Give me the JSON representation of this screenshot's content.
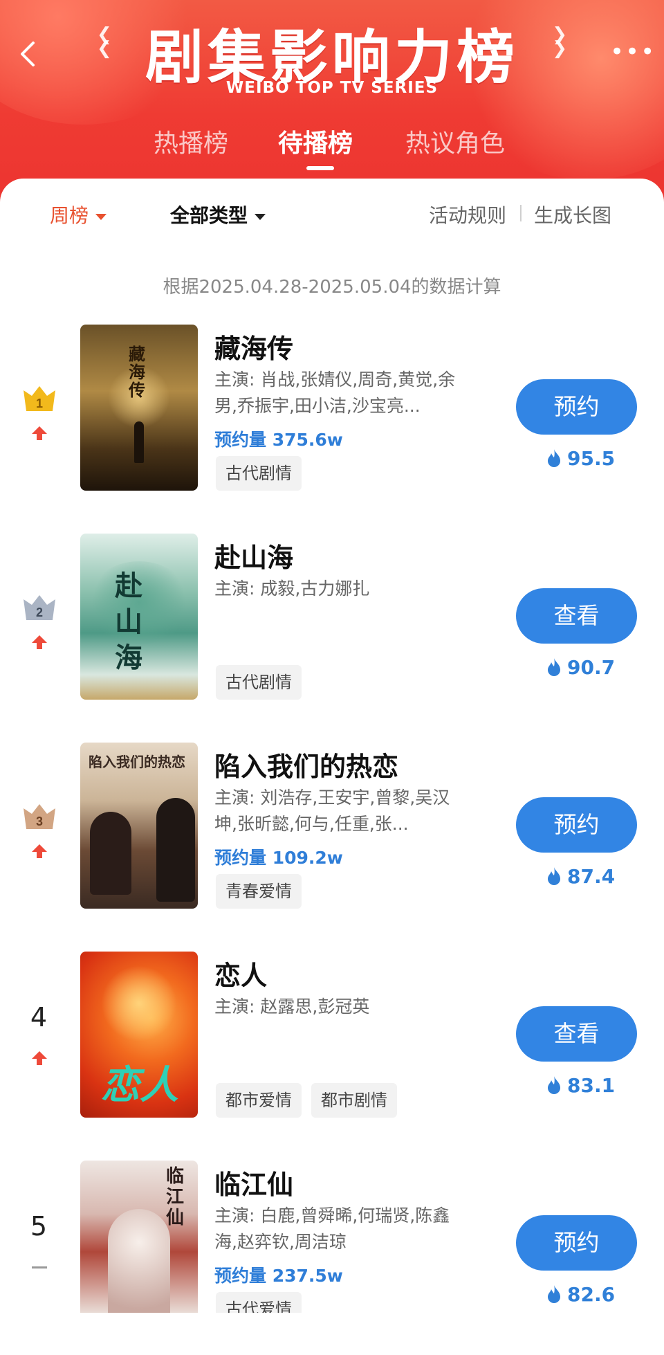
{
  "header": {
    "title": "剧集影响力榜",
    "subtitle": "WEIBO TOP TV SERIES",
    "tabs": [
      {
        "label": "热播榜",
        "active": false
      },
      {
        "label": "待播榜",
        "active": true
      },
      {
        "label": "热议角色",
        "active": false
      }
    ]
  },
  "filters": {
    "period": "周榜",
    "type": "全部类型",
    "rules": "活动规则",
    "generate_image": "生成长图"
  },
  "data_note": "根据2025.04.28-2025.05.04的数据计算",
  "colors": {
    "header_red": "#ef3b33",
    "accent_blue": "#3285e4",
    "filter_red": "#e8512f"
  },
  "shows": [
    {
      "rank": "1",
      "trend": "up",
      "title": "藏海传",
      "cast": "主演: 肖战,张婧仪,周奇,黄觉,余男,乔振宇,田小洁,沙宝亮...",
      "reserve_label": "预约量",
      "reserve_value": "375.6w",
      "tags": [
        "古代剧情"
      ],
      "action": "预约",
      "heat": "95.5",
      "poster_text": "藏海传"
    },
    {
      "rank": "2",
      "trend": "up",
      "title": "赴山海",
      "cast": "主演: 成毅,古力娜扎",
      "tags": [
        "古代剧情"
      ],
      "action": "查看",
      "heat": "90.7",
      "poster_text": "赴山海"
    },
    {
      "rank": "3",
      "trend": "up",
      "title": "陷入我们的热恋",
      "cast": "主演: 刘浩存,王安宇,曾黎,吴汉坤,张昕懿,何与,任重,张...",
      "reserve_label": "预约量",
      "reserve_value": "109.2w",
      "tags": [
        "青春爱情"
      ],
      "action": "预约",
      "heat": "87.4",
      "poster_text": "陷入我们的热恋"
    },
    {
      "rank": "4",
      "trend": "up",
      "title": "恋人",
      "cast": "主演: 赵露思,彭冠英",
      "tags": [
        "都市爱情",
        "都市剧情"
      ],
      "action": "查看",
      "heat": "83.1",
      "poster_text": "恋人"
    },
    {
      "rank": "5",
      "trend": "flat",
      "title": "临江仙",
      "cast": "主演: 白鹿,曾舜晞,何瑞贤,陈鑫海,赵弈钦,周洁琼",
      "reserve_label": "预约量",
      "reserve_value": "237.5w",
      "tags": [
        "古代爱情"
      ],
      "action": "预约",
      "heat": "82.6",
      "poster_text": "临江仙"
    }
  ]
}
